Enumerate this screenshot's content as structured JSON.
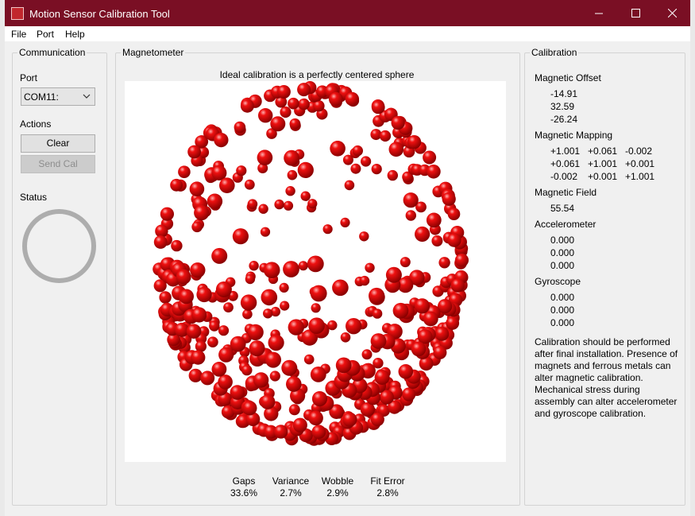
{
  "window": {
    "title": "Motion Sensor Calibration Tool"
  },
  "menu": {
    "file": "File",
    "port": "Port",
    "help": "Help"
  },
  "communication": {
    "group_label": "Communication",
    "port_label": "Port",
    "port_value": "COM11:",
    "actions_label": "Actions",
    "clear_button": "Clear",
    "send_cal_button": "Send Cal",
    "status_label": "Status"
  },
  "magnetometer": {
    "group_label": "Magnetometer",
    "caption": "Ideal calibration is a perfectly centered sphere",
    "point_color": "#e00000",
    "stats": [
      {
        "name": "Gaps",
        "value": "33.6%"
      },
      {
        "name": "Variance",
        "value": "2.7%"
      },
      {
        "name": "Wobble",
        "value": "2.9%"
      },
      {
        "name": "Fit Error",
        "value": "2.8%"
      }
    ]
  },
  "calibration": {
    "group_label": "Calibration",
    "magnetic_offset_label": "Magnetic Offset",
    "magnetic_offset": [
      "-14.91",
      "32.59",
      "-26.24"
    ],
    "magnetic_mapping_label": "Magnetic Mapping",
    "magnetic_mapping": [
      [
        "+1.001",
        "+0.061",
        "-0.002"
      ],
      [
        "+0.061",
        "+1.001",
        "+0.001"
      ],
      [
        "-0.002",
        "+0.001",
        "+1.001"
      ]
    ],
    "magnetic_field_label": "Magnetic Field",
    "magnetic_field": "55.54",
    "accelerometer_label": "Accelerometer",
    "accelerometer": [
      "0.000",
      "0.000",
      "0.000"
    ],
    "gyroscope_label": "Gyroscope",
    "gyroscope": [
      "0.000",
      "0.000",
      "0.000"
    ],
    "note": "Calibration should be performed after final installation.  Presence of magnets and ferrous metals can alter magnetic calibration. Mechanical stress during assembly can alter accelerometer and gyroscope calibration."
  }
}
